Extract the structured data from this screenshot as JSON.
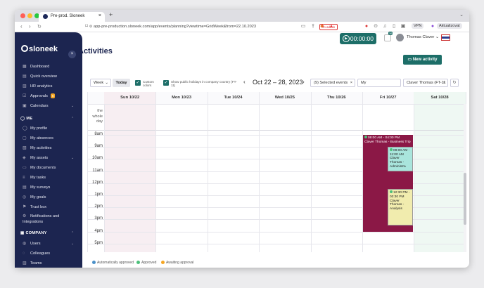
{
  "browser": {
    "tab_title": "Pre-prod. Sloneek",
    "url": "app-pre-production.sloneek.com/app/events/planning?viewtime=GridWeek&from=22.10.2023",
    "vpn": "VPN",
    "update_label": "Aktualizovat"
  },
  "sidebar": {
    "logo": "sloneek",
    "top_items": [
      {
        "label": "Dashboard",
        "icon": "dashboard-icon"
      },
      {
        "label": "Quick overview",
        "icon": "overview-icon"
      },
      {
        "label": "HR analytics",
        "icon": "chart-icon"
      },
      {
        "label": "Approvals",
        "icon": "approvals-icon",
        "badge": "5"
      },
      {
        "label": "Calendars",
        "icon": "calendar-icon"
      }
    ],
    "me_section": "ME",
    "me_items": [
      {
        "label": "My profile",
        "icon": "profile-icon"
      },
      {
        "label": "My absences",
        "icon": "absence-icon"
      },
      {
        "label": "My activities",
        "icon": "activity-icon"
      },
      {
        "label": "My assets",
        "icon": "asset-icon"
      },
      {
        "label": "My documents",
        "icon": "document-icon"
      },
      {
        "label": "My tasks",
        "icon": "task-icon"
      },
      {
        "label": "My surveys",
        "icon": "survey-icon"
      },
      {
        "label": "My goals",
        "icon": "goal-icon"
      },
      {
        "label": "Trust box",
        "icon": "trustbox-icon"
      },
      {
        "label": "Notifications and Integrations",
        "icon": "settings-icon"
      }
    ],
    "company_section": "COMPANY",
    "company_items": [
      {
        "label": "Users",
        "icon": "users-icon"
      },
      {
        "label": "Colleagues",
        "icon": "colleagues-icon"
      },
      {
        "label": "Teams",
        "icon": "teams-icon"
      }
    ]
  },
  "header": {
    "title": "Activities",
    "admin_label": "To admin",
    "timer": "00:00:00",
    "notif_count": "36",
    "user_name": "Thomas Claver",
    "new_activity_label": "New activity"
  },
  "toolbar": {
    "view": "Week",
    "today": "Today",
    "custom_colors": "Custom colors",
    "public_holidays": "Show public holidays in company country (FT-11)",
    "date_range": "Oct 22 – 28, 2023",
    "selected_events": "(9) Selected events",
    "filter_scope": "My",
    "person": "Claver Thomas (FT-11"
  },
  "calendar": {
    "days": [
      "Sun 10/22",
      "Mon 10/23",
      "Tue 10/24",
      "Wed 10/25",
      "Thu 10/26",
      "Fri 10/27",
      "Sat 10/28"
    ],
    "all_day_label": "the whole day",
    "hours": [
      "8am",
      "9am",
      "10am",
      "11am",
      "12pm",
      "1pm",
      "2pm",
      "3pm",
      "4pm",
      "5pm"
    ],
    "events": [
      {
        "time": "08:00 AM - 04:00 PM",
        "title": "Claver Thomas - Business Trip",
        "day": 5,
        "start": 8,
        "end": 16,
        "color": "#8b1846"
      },
      {
        "time": "09:00 AM - 11:00 AM",
        "title": "Claver Thomas - Administra",
        "day": 5,
        "start": 9,
        "end": 11,
        "color": "#a9e5dc"
      },
      {
        "time": "12:30 PM - 03:30 PM",
        "title": "Claver Thomas - Analysis",
        "day": 5,
        "start": 12.5,
        "end": 15.5,
        "color": "#f1ecae"
      }
    ]
  },
  "legend": [
    {
      "label": "Automatically approved",
      "color": "#4a90c8"
    },
    {
      "label": "Approved",
      "color": "#4cc07a"
    },
    {
      "label": "Awaiting approval",
      "color": "#f5a623"
    }
  ]
}
